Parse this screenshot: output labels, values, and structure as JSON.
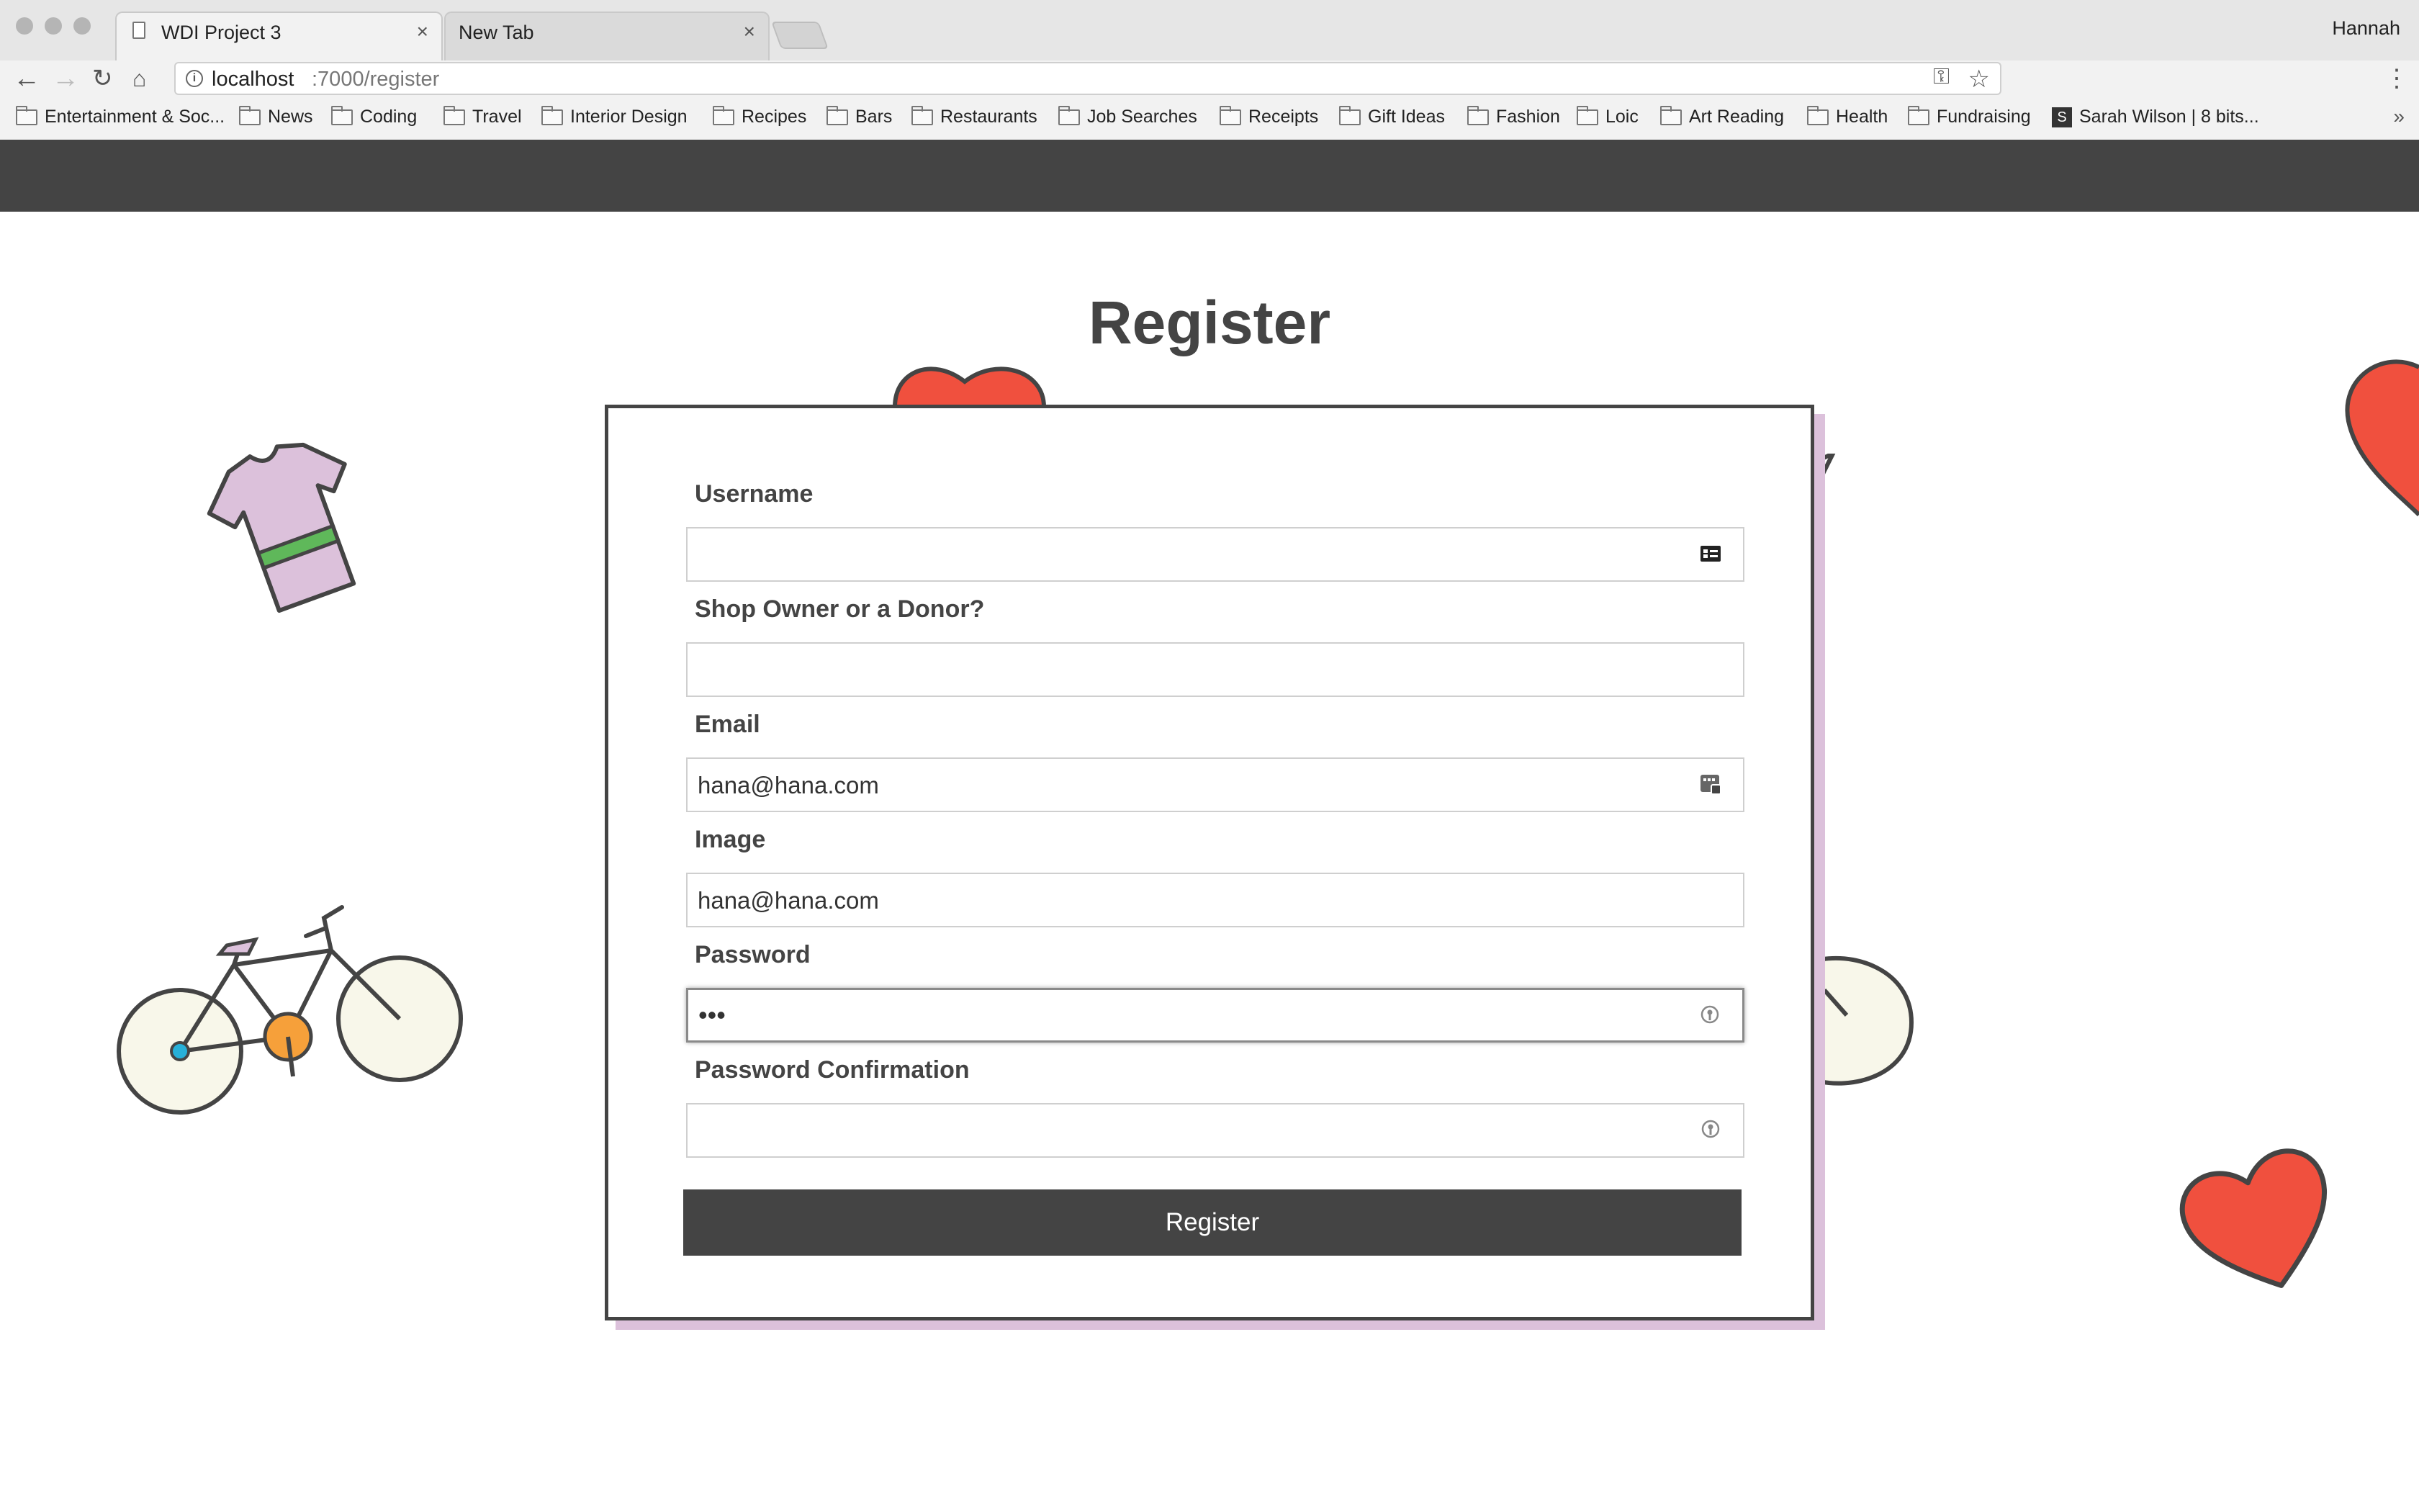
{
  "browser": {
    "tabs": [
      {
        "title": "WDI Project 3"
      },
      {
        "title": "New Tab"
      }
    ],
    "profile_name": "Hannah",
    "url_host": "localhost",
    "url_path": ":7000/register",
    "bookmarks": [
      "Entertainment & Soc...",
      "News",
      "Coding",
      "Travel",
      "Interior Design",
      "Recipes",
      "Bars",
      "Restaurants",
      "Job Searches",
      "Receipts",
      "Gift Ideas",
      "Fashion",
      "Loic",
      "Art Reading",
      "Health",
      "Fundraising",
      "Sarah Wilson | 8 bits..."
    ],
    "bookmarks_overflow": "»"
  },
  "page": {
    "title": "Register",
    "form": {
      "username_label": "Username",
      "username_value": "",
      "role_label": "Shop Owner or a Donor?",
      "role_value": "",
      "email_label": "Email",
      "email_value": "hana@hana.com",
      "image_label": "Image",
      "image_value": "hana@hana.com",
      "password_label": "Password",
      "password_value": "•••",
      "password_confirmation_label": "Password Confirmation",
      "password_confirmation_value": "",
      "submit_label": "Register"
    }
  },
  "colors": {
    "nav_bar": "#444444",
    "accent_pink": "#dcc1db",
    "heart_red": "#f0503e"
  }
}
